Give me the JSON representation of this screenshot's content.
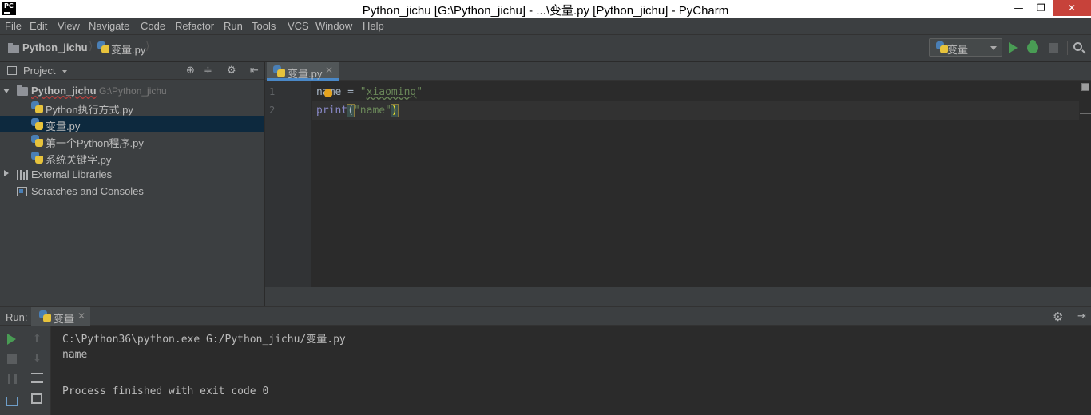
{
  "window": {
    "app_icon_text": "PC",
    "title": "Python_jichu [G:\\Python_jichu] - ...\\变量.py [Python_jichu] - PyCharm",
    "minimize": "—",
    "maximize": "❐",
    "close": "✕"
  },
  "menu": [
    "File",
    "Edit",
    "View",
    "Navigate",
    "Code",
    "Refactor",
    "Run",
    "Tools",
    "VCS",
    "Window",
    "Help"
  ],
  "navbar": {
    "project_crumb": "Python_jichu",
    "file_crumb": "变量.py",
    "run_config": "变量"
  },
  "project_panel": {
    "header": "Project",
    "root": {
      "name": "Python_jichu",
      "path": "G:\\Python_jichu"
    },
    "files": [
      "Python执行方式.py",
      "变量.py",
      "第一个Python程序.py",
      "系统关键字.py"
    ],
    "external_libraries": "External Libraries",
    "scratches": "Scratches and Consoles"
  },
  "editor": {
    "tab_label": "变量.py",
    "line_numbers": [
      "1",
      "2"
    ],
    "line1": {
      "var": "name",
      "op": " = ",
      "q1": "\"",
      "str": "xiaoming",
      "q2": "\""
    },
    "line2": {
      "func": "print",
      "open": "(",
      "str": "\"name\"",
      "close": ")"
    }
  },
  "run_panel": {
    "label": "Run:",
    "tab_label": "变量",
    "output": [
      "C:\\Python36\\python.exe G:/Python_jichu/变量.py",
      "name",
      "",
      "Process finished with exit code 0"
    ]
  },
  "colors": {
    "background": "#2b2b2b",
    "panel": "#3c3f41",
    "selection": "#0d293e",
    "string": "#6a8759",
    "builtin": "#8888c6",
    "run_green": "#499c54"
  }
}
